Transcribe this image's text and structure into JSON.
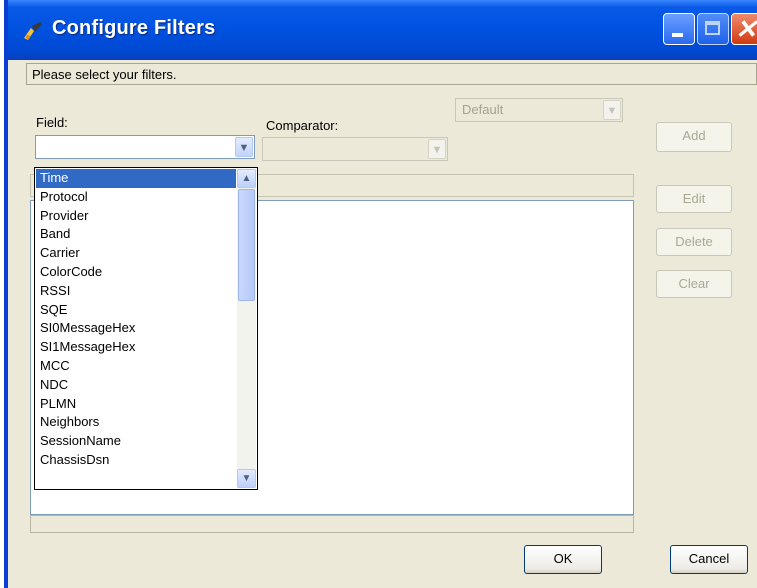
{
  "window": {
    "title": "Configure Filters"
  },
  "prompt": "Please select your filters.",
  "field": {
    "label": "Field:",
    "value": ""
  },
  "comparator": {
    "label": "Comparator:",
    "value": ""
  },
  "default_combo": {
    "value": "Default"
  },
  "buttons": {
    "add": "Add",
    "edit": "Edit",
    "delete": "Delete",
    "clear": "Clear",
    "ok": "OK",
    "cancel": "Cancel"
  },
  "field_options": [
    "Time",
    "Protocol",
    "Provider",
    "Band",
    "Carrier",
    "ColorCode",
    "RSSI",
    "SQE",
    "SI0MessageHex",
    "SI1MessageHex",
    "MCC",
    "NDC",
    "PLMN",
    "Neighbors",
    "SessionName",
    "ChassisDsn"
  ],
  "selected_option": "Time",
  "icons": {
    "app": "filter-tool-icon",
    "minimize": "minimize-icon",
    "maximize": "maximize-icon",
    "close": "close-icon",
    "dropdown": "chevron-down-icon",
    "scroll_up": "chevron-up-icon"
  },
  "colors": {
    "titlebar": "#0051e0",
    "selection": "#316ac5",
    "close_button": "#d23a10"
  }
}
